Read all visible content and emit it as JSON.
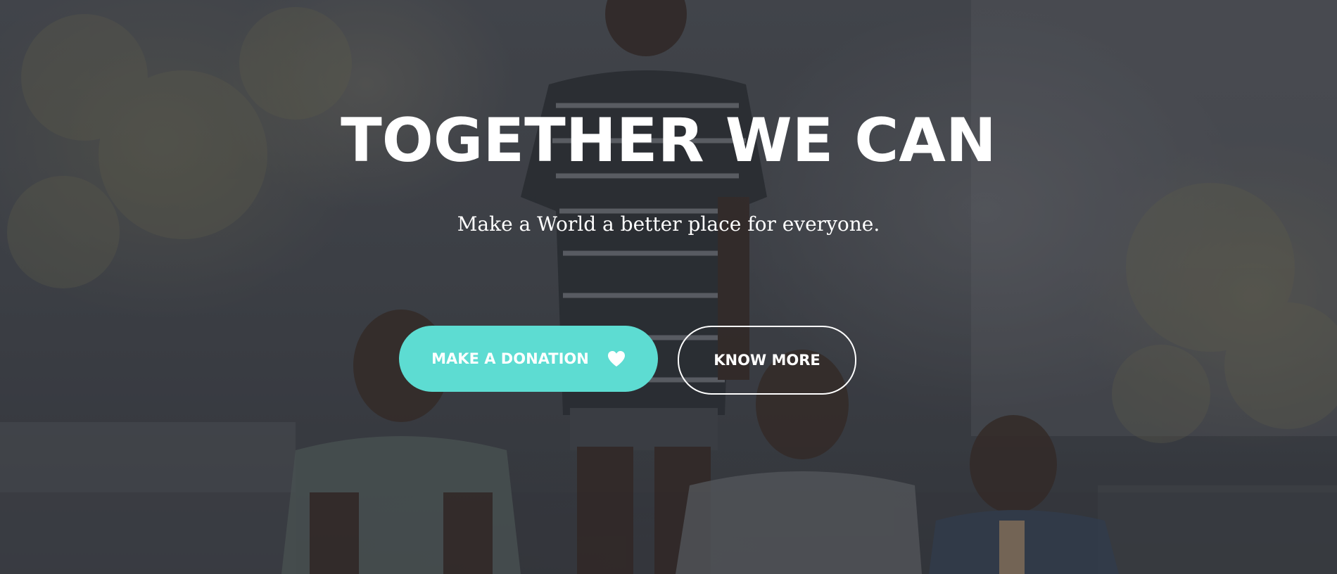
{
  "hero": {
    "title": "TOGETHER WE CAN",
    "subtitle": "Make a World a better place for everyone.",
    "background_description_icon": "photo-children-background",
    "buttons": {
      "donate_label": "MAKE A DONATION",
      "donate_icon": "heart-icon",
      "more_label": "KNOW MORE"
    }
  },
  "colors": {
    "accent": "#5ddcd2",
    "text": "#ffffff",
    "overlay": "#23262c"
  }
}
